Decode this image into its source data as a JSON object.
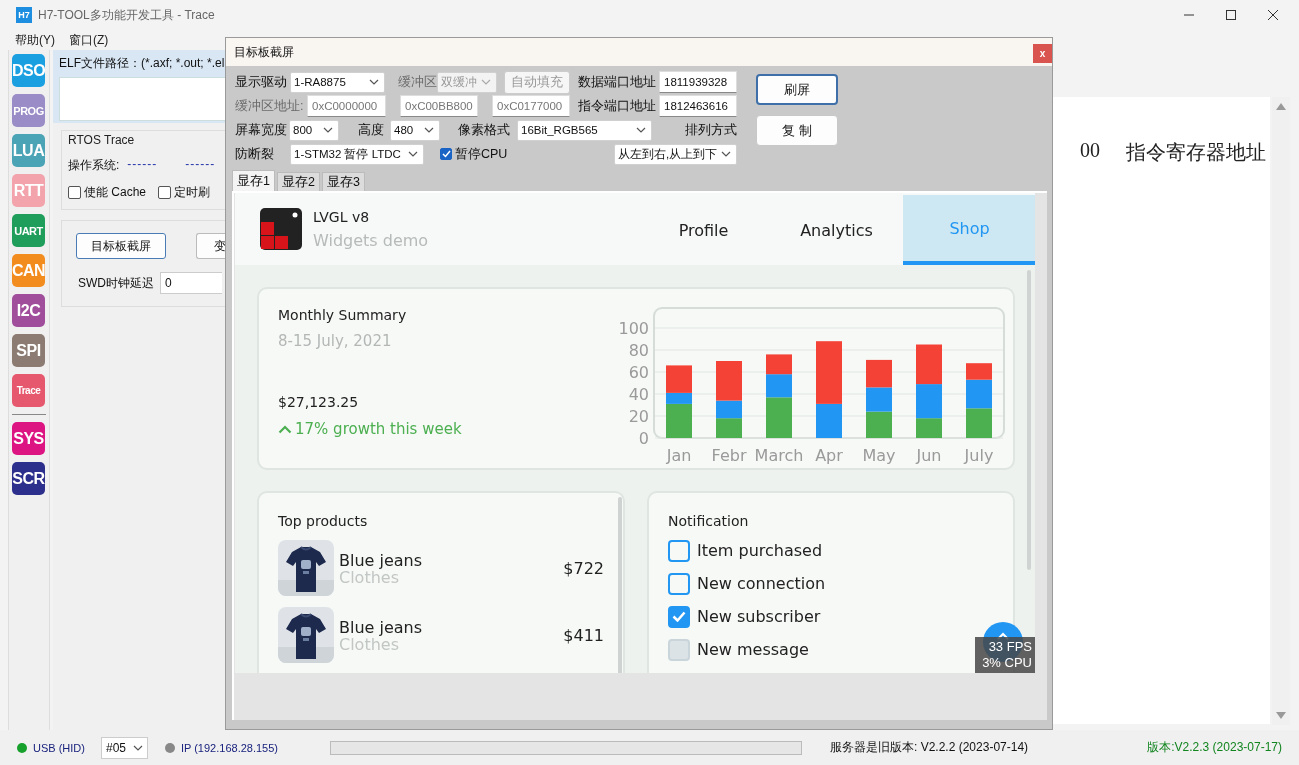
{
  "window": {
    "badge": "H7",
    "title": "H7-TOOL多功能开发工具 - Trace"
  },
  "menu": [
    {
      "label": "帮助(Y)"
    },
    {
      "label": "窗口(Z)"
    }
  ],
  "tool_groups": [
    [
      {
        "label": "DSO",
        "color": "#1a9fe0"
      },
      {
        "label": "PROG",
        "color": "#9a8cc6"
      },
      {
        "label": "LUA",
        "color": "#4aa4b6"
      },
      {
        "label": "RTT",
        "color": "#f2a3ab"
      },
      {
        "label": "UART",
        "color": "#1f9d5b"
      },
      {
        "label": "CAN",
        "color": "#f28c1f"
      },
      {
        "label": "I2C",
        "color": "#a04e9c"
      },
      {
        "label": "SPI",
        "color": "#8b7b72"
      },
      {
        "label": "Trace",
        "color": "#e6586e"
      }
    ],
    [
      {
        "label": "SYS",
        "color": "#dd1582"
      },
      {
        "label": "SCR",
        "color": "#2d2f8c"
      }
    ]
  ],
  "left_panel": {
    "elf_path_label": "ELF文件路径：(*.axf; *.out; *.el",
    "rtos_group": "RTOS Trace",
    "os_label": "操作系统:",
    "os_value": "------",
    "os_value_2": "------",
    "checkboxes": [
      {
        "label": "使能 Cache",
        "checked": false
      },
      {
        "label": "定时刷",
        "checked": false
      }
    ],
    "buttons": [
      "目标板截屏",
      "变"
    ],
    "swd_label": "SWD时钟延迟",
    "swd_value": "0"
  },
  "work_area": {
    "text_1": "00",
    "text_2": "指令寄存器地址"
  },
  "dialog": {
    "title": "目标板截屏",
    "close": "x",
    "driver": {
      "label": "显示驱动",
      "value": "1-RA8875"
    },
    "buffer_mode": {
      "label": "缓冲区",
      "value": "双缓冲",
      "disabled": true
    },
    "auto_fill": {
      "label": "自动填充",
      "disabled": true
    },
    "data_port": {
      "label": "数据端口地址",
      "value": "1811939328"
    },
    "buffer_address": {
      "label": "缓冲区地址:",
      "disabled": true,
      "values": [
        "0xC0000000",
        "0xC00BB800",
        "0xC0177000"
      ]
    },
    "command_port": {
      "label": "指令端口地址",
      "value": "1812463616"
    },
    "screen_width": {
      "label": "屏幕宽度",
      "value": "800"
    },
    "screen_height": {
      "label": "高度",
      "value": "480"
    },
    "pixel_format": {
      "label": "像素格式",
      "value": "16Bit_RGB565"
    },
    "order": {
      "label": "排列方式",
      "value": "从左到右,从上到下"
    },
    "anti_tear": {
      "label": "防断裂",
      "value": "1-STM32 暂停 LTDC"
    },
    "pause_cpu": {
      "label": "暂停CPU",
      "checked": true
    },
    "buttons": [
      {
        "label": "刷屏",
        "default": true
      },
      {
        "label": "复 制",
        "default": false
      }
    ],
    "tabs": [
      {
        "label": "显存1",
        "selected": true
      },
      {
        "label": "显存2",
        "selected": false
      },
      {
        "label": "显存3",
        "selected": false
      }
    ],
    "screen": {
      "title": "LVGL v8",
      "subtitle": "Widgets demo",
      "tabs": [
        {
          "label": "Profile",
          "selected": false
        },
        {
          "label": "Analytics",
          "selected": false
        },
        {
          "label": "Shop",
          "selected": true
        }
      ],
      "summary": {
        "title": "Monthly Summary",
        "date": "8-15 July, 2021",
        "amount": "$27,123.25",
        "growth": "17% growth this week",
        "chart_data": {
          "type": "bar",
          "stacked": true,
          "grid": true,
          "categories": [
            "Jan",
            "Febr",
            "March",
            "Apr",
            "May",
            "Jun",
            "July"
          ],
          "ylim": [
            0,
            100
          ],
          "yticks": [
            0,
            20,
            40,
            60,
            80,
            100
          ],
          "series": [
            {
              "color": "#4caf50",
              "values": [
                31,
                18,
                37,
                0,
                24,
                18,
                27
              ]
            },
            {
              "color": "#2196f3",
              "values": [
                10,
                16,
                21,
                31,
                22,
                31,
                26
              ]
            },
            {
              "color": "#f44336",
              "values": [
                25,
                36,
                18,
                57,
                25,
                36,
                15
              ]
            }
          ]
        }
      },
      "products": {
        "title": "Top products",
        "items": [
          {
            "name": "Blue jeans",
            "category": "Clothes",
            "price": "$722"
          },
          {
            "name": "Blue jeans",
            "category": "Clothes",
            "price": "$411"
          }
        ]
      },
      "notifications": {
        "title": "Notification",
        "items": [
          {
            "label": "Item purchased",
            "checked": false,
            "disabled": false
          },
          {
            "label": "New connection",
            "checked": false,
            "disabled": false
          },
          {
            "label": "New subscriber",
            "checked": true,
            "disabled": false
          },
          {
            "label": "New message",
            "checked": false,
            "disabled": true
          }
        ]
      },
      "fps": "33 FPS",
      "cpu": "3% CPU"
    }
  },
  "status_bar": {
    "usb": {
      "label": "USB (HID)",
      "connected": true
    },
    "port": "#05",
    "ip": {
      "label": "IP (192.168.28.155)",
      "connected": false
    },
    "progress": {
      "level": 0
    },
    "server_message": "服务器是旧版本: V2.2.2 (2023-07-14)",
    "version": "版本:V2.2.3 (2023-07-17)"
  }
}
